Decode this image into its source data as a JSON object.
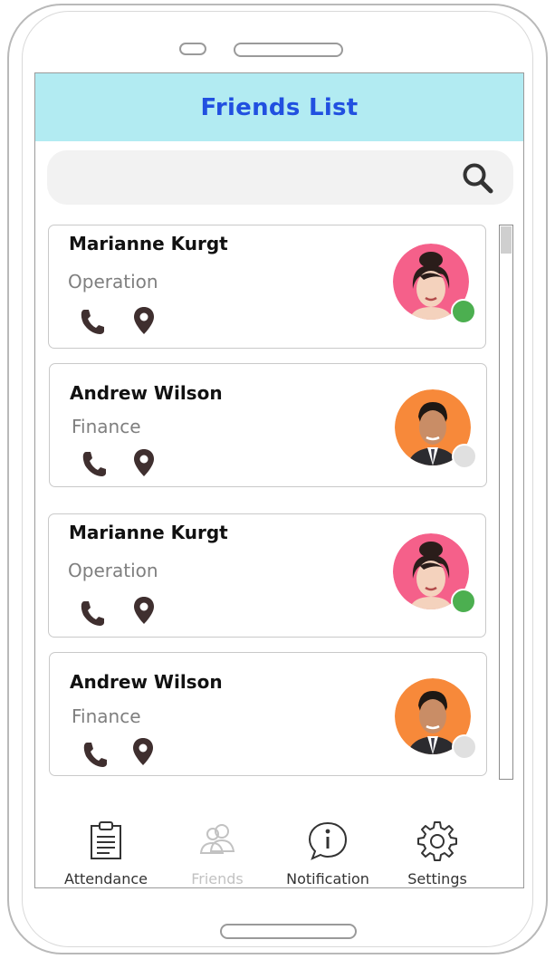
{
  "header": {
    "title": "Friends List"
  },
  "search": {
    "icon": "search-icon"
  },
  "friends": [
    {
      "name": "Marianne Kurgt",
      "department": "Operation",
      "online": true,
      "avatar_color": "#f5608a"
    },
    {
      "name": "Andrew Wilson",
      "department": "Finance",
      "online": false,
      "avatar_color": "#f7893a"
    },
    {
      "name": "Marianne Kurgt",
      "department": "Operation",
      "online": true,
      "avatar_color": "#f5608a"
    },
    {
      "name": "Andrew Wilson",
      "department": "Finance",
      "online": false,
      "avatar_color": "#f7893a"
    }
  ],
  "tabs": [
    {
      "label": "Attendance",
      "icon": "clipboard-icon",
      "enabled": true
    },
    {
      "label": "Friends",
      "icon": "friends-icon",
      "enabled": false
    },
    {
      "label": "Notification",
      "icon": "info-bubble-icon",
      "enabled": true
    },
    {
      "label": "Settings",
      "icon": "gear-icon",
      "enabled": true
    }
  ],
  "colors": {
    "header_bg": "#b2ebf2",
    "title": "#2150e0",
    "online": "#4caf50",
    "offline": "#e0e0e0"
  }
}
